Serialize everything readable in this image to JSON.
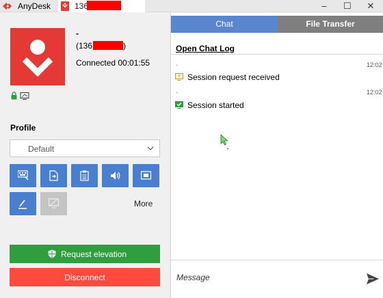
{
  "titlebar": {
    "app_name": "AnyDesk",
    "session_tab_label": "136",
    "window_controls": {
      "minimize": "–",
      "maximize": "☐",
      "close": "✕"
    }
  },
  "session": {
    "remote_name": "-",
    "remote_id_prefix": "(136",
    "remote_id_suffix": ")",
    "status": "Connected 00:01:55"
  },
  "profile": {
    "label": "Profile",
    "selected": "Default"
  },
  "toolbar": {
    "tools": [
      {
        "icon": "keyboard-icon"
      },
      {
        "icon": "file-transfer-icon"
      },
      {
        "icon": "clipboard-icon"
      },
      {
        "icon": "speaker-icon"
      },
      {
        "icon": "screen-icon"
      },
      {
        "icon": "pen-icon"
      },
      {
        "icon": "disabled-monitor-icon"
      }
    ],
    "more_label": "More"
  },
  "actions": {
    "request_elevation": "Request elevation",
    "disconnect": "Disconnect"
  },
  "tabs": {
    "chat": "Chat",
    "file_transfer": "File Transfer"
  },
  "chat": {
    "open_log_label": "Open Chat Log",
    "messages": [
      {
        "sender": "-",
        "time": "12:02",
        "text": "Session request received"
      },
      {
        "sender": "-",
        "time": "12:02",
        "text": "Session started"
      }
    ],
    "input_placeholder": "Message"
  },
  "colors": {
    "brand_red": "#e53935",
    "tool_blue": "#4a7ecf",
    "chat_tab": "#5a86d0",
    "file_tab": "#7f7f7f",
    "elevation_green": "#2e9e3e",
    "disconnect_red": "#ff4a3f"
  }
}
